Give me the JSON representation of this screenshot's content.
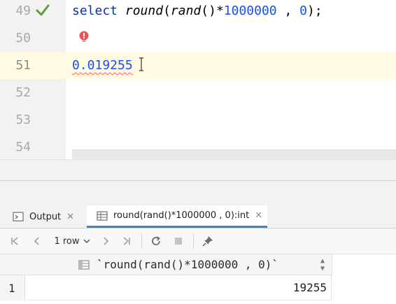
{
  "editor": {
    "lines": [
      {
        "num": "49",
        "status_icon": "check-icon"
      },
      {
        "num": "50",
        "status_icon": "bulb-icon"
      },
      {
        "num": "51"
      },
      {
        "num": "52"
      },
      {
        "num": "53"
      },
      {
        "num": "54"
      }
    ],
    "query": {
      "kw": "select",
      "fn1": "round",
      "paren1": "(",
      "fn2": "rand",
      "mid": "()*",
      "num1": "1000000",
      "comma": " , ",
      "num2": "0",
      "end": ");"
    },
    "result_text": "0.019255"
  },
  "tabs": [
    {
      "label": "Output",
      "icon": "output-icon"
    },
    {
      "label": "round(rand()*1000000 , 0):int",
      "icon": "table-icon",
      "active": true
    }
  ],
  "toolbar": {
    "rows_label": "1 row",
    "icons": [
      "first-page-icon",
      "prev-page-icon",
      "next-page-icon",
      "last-page-icon",
      "refresh-icon",
      "stop-icon",
      "pin-icon"
    ]
  },
  "grid": {
    "column_header": "`round(rand()*1000000 , 0)`",
    "row_number": "1",
    "cell_value": "19255"
  }
}
